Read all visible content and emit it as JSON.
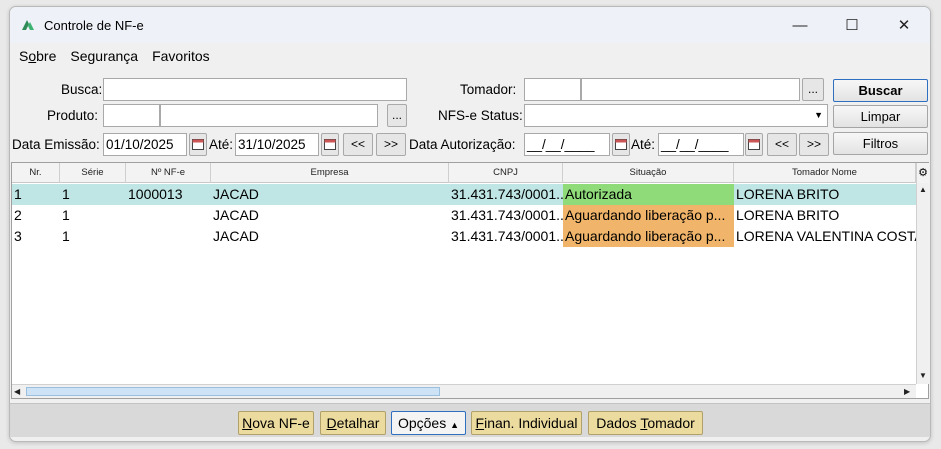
{
  "window": {
    "title": "Controle de NF-e",
    "minimize": "—",
    "maximize": "☐",
    "close": "✕"
  },
  "menu": {
    "items": [
      {
        "label": "Sobre",
        "underline_index": 1
      },
      {
        "label": "Segurança"
      },
      {
        "label": "Favoritos"
      }
    ]
  },
  "filters": {
    "busca_label": "Busca:",
    "busca_value": "",
    "produto_label": "Produto:",
    "produto_code": "",
    "produto_name": "",
    "ellipsis": "...",
    "emissao_label": "Data Emissão:",
    "emissao_from": "01/10/2025",
    "ate_label": "Até:",
    "emissao_to": "31/10/2025",
    "prev": "<<",
    "next": ">>",
    "tomador_label": "Tomador:",
    "tomador_code": "",
    "tomador_name": "",
    "status_label": "NFS-e Status:",
    "status_value": "",
    "autorizacao_label": "Data Autorização:",
    "autorizacao_from": "__/__/____",
    "autorizacao_to": "__/__/____"
  },
  "actions": {
    "buscar": "Buscar",
    "limpar": "Limpar",
    "filtros": "Filtros"
  },
  "grid": {
    "columns": [
      "Nr.",
      "Série",
      "Nº NF-e",
      "Empresa",
      "CNPJ",
      "Situação",
      "Tomador Nome"
    ],
    "rows": [
      {
        "nr": "1",
        "serie": "1",
        "nfe": "1000013",
        "empresa": "JACAD",
        "cnpj": "31.431.743/0001...",
        "situacao": "Autorizada",
        "tomador": "LORENA BRITO",
        "status_color": "#8fdb7a",
        "selected": true
      },
      {
        "nr": "2",
        "serie": "1",
        "nfe": "",
        "empresa": "JACAD",
        "cnpj": "31.431.743/0001...",
        "situacao": "Aguardando liberação p...",
        "tomador": "LORENA BRITO",
        "status_color": "#f0b56a",
        "selected": false
      },
      {
        "nr": "3",
        "serie": "1",
        "nfe": "",
        "empresa": "JACAD",
        "cnpj": "31.431.743/0001...",
        "situacao": "Aguardando liberação p...",
        "tomador": "LORENA VALENTINA COSTA",
        "status_color": "#f0b56a",
        "selected": false
      }
    ],
    "selected_row_color": "#bfe6e4"
  },
  "bottom": {
    "nova": "Nova NF-e",
    "detalhar": "Detalhar",
    "opcoes": "Opções",
    "finan": "Finan. Individual",
    "dados": "Dados Tomador"
  },
  "icons": [
    "app-logo-icon",
    "calendar-icon",
    "gear-icon",
    "caret-up-icon",
    "dropdown-arrow-icon"
  ]
}
